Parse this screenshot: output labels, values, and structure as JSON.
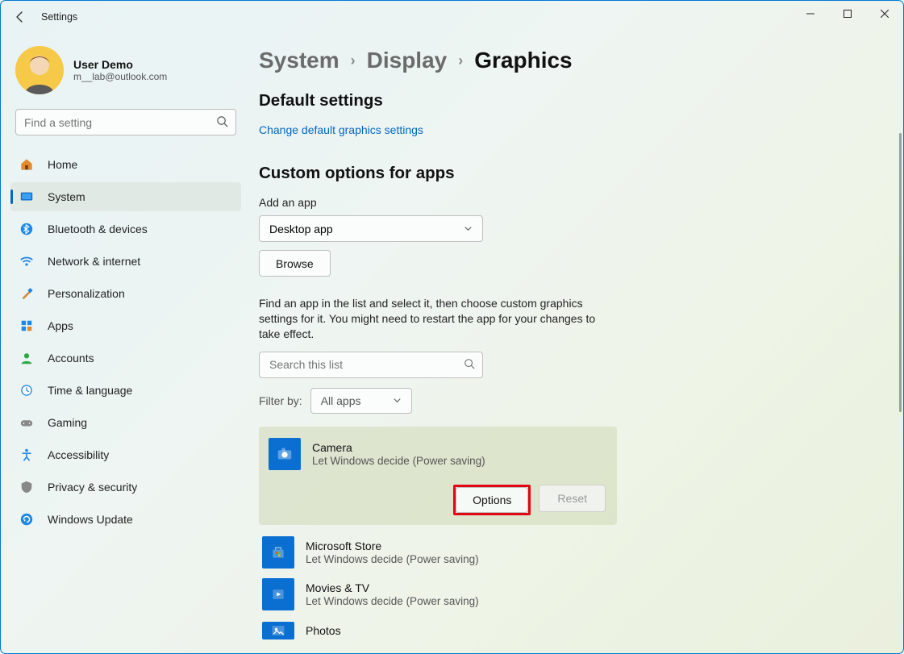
{
  "window": {
    "title": "Settings"
  },
  "profile": {
    "name": "User Demo",
    "email": "m__lab@outlook.com"
  },
  "search": {
    "placeholder": "Find a setting"
  },
  "sidebar": {
    "items": [
      {
        "label": "Home"
      },
      {
        "label": "System"
      },
      {
        "label": "Bluetooth & devices"
      },
      {
        "label": "Network & internet"
      },
      {
        "label": "Personalization"
      },
      {
        "label": "Apps"
      },
      {
        "label": "Accounts"
      },
      {
        "label": "Time & language"
      },
      {
        "label": "Gaming"
      },
      {
        "label": "Accessibility"
      },
      {
        "label": "Privacy & security"
      },
      {
        "label": "Windows Update"
      }
    ],
    "active_index": 1
  },
  "breadcrumb": {
    "a": "System",
    "b": "Display",
    "c": "Graphics"
  },
  "main": {
    "default_heading": "Default settings",
    "default_link": "Change default graphics settings",
    "custom_heading": "Custom options for apps",
    "add_label": "Add an app",
    "app_type_value": "Desktop app",
    "browse_label": "Browse",
    "description": "Find an app in the list and select it, then choose custom graphics settings for it. You might need to restart the app for your changes to take effect.",
    "list_search_placeholder": "Search this list",
    "filter_label": "Filter by:",
    "filter_value": "All apps",
    "options_label": "Options",
    "reset_label": "Reset",
    "apps": [
      {
        "name": "Camera",
        "sub": "Let Windows decide (Power saving)",
        "color": "#0a6fd1"
      },
      {
        "name": "Microsoft Store",
        "sub": "Let Windows decide (Power saving)",
        "color": "#0a6fd1"
      },
      {
        "name": "Movies & TV",
        "sub": "Let Windows decide (Power saving)",
        "color": "#0a6fd1"
      },
      {
        "name": "Photos",
        "sub": "",
        "color": "#0a6fd1"
      }
    ]
  }
}
